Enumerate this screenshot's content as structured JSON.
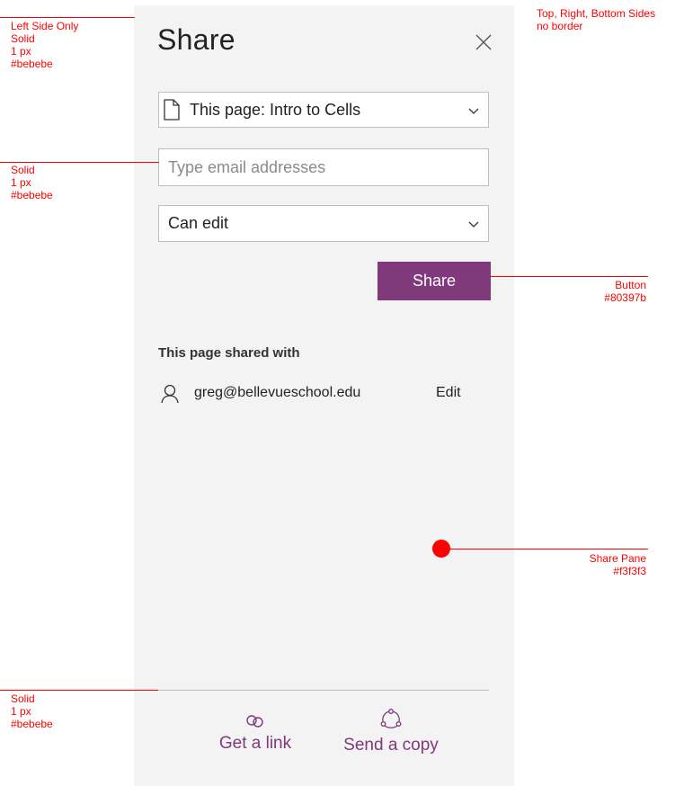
{
  "annotations": {
    "top_left": "Left Side Only\nSolid\n1 px\n#bebebe",
    "middle_left": "Solid\n1 px\n#bebebe",
    "bottom_left": "Solid\n1 px\n#bebebe",
    "top_right": "Top, Right, Bottom Sides\nno border",
    "button": "Button\n#80397b",
    "pane": "Share Pane\n#f3f3f3"
  },
  "pane": {
    "title": "Share",
    "page_select": "This page: Intro to Cells",
    "email_placeholder": "Type email addresses",
    "permission_select": "Can edit",
    "share_button": "Share",
    "shared_with_title": "This page shared with",
    "shared_users": [
      {
        "email": "greg@bellevueschool.edu",
        "permission": "Edit"
      }
    ],
    "get_link": "Get a link",
    "send_copy": "Send a copy"
  },
  "colors": {
    "pane_bg": "#f3f3f3",
    "border": "#bebebe",
    "accent": "#80397b",
    "annotation": "#ff0000"
  },
  "icons": [
    "close-icon",
    "document-icon",
    "chevron-down-icon",
    "person-icon",
    "link-icon",
    "send-copy-icon"
  ]
}
